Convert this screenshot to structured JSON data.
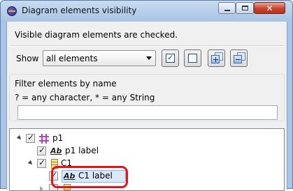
{
  "window": {
    "title": "Diagram elements visibility",
    "close_symbol": "✕"
  },
  "description": "Visible diagram elements are checked.",
  "show": {
    "label": "Show",
    "selected": "all elements"
  },
  "toolbar": {
    "icons": [
      "check-all-icon",
      "uncheck-all-icon",
      "expand-all-icon",
      "collapse-all-icon"
    ]
  },
  "filter": {
    "title": "Filter elements by name",
    "hint": "? = any character, * = any String",
    "value": ""
  },
  "tree": {
    "items": [
      {
        "label": "p1",
        "icon": "package-icon",
        "checked": true
      },
      {
        "label": "p1 label",
        "icon": "label-icon",
        "checked": true
      },
      {
        "label": "C1",
        "icon": "class-icon",
        "checked": true
      },
      {
        "label": "C1 label",
        "icon": "label-icon",
        "checked": true,
        "selected": true
      }
    ]
  },
  "colors": {
    "highlight_ring": "#e3141b",
    "selection": "#dbe8f7"
  }
}
